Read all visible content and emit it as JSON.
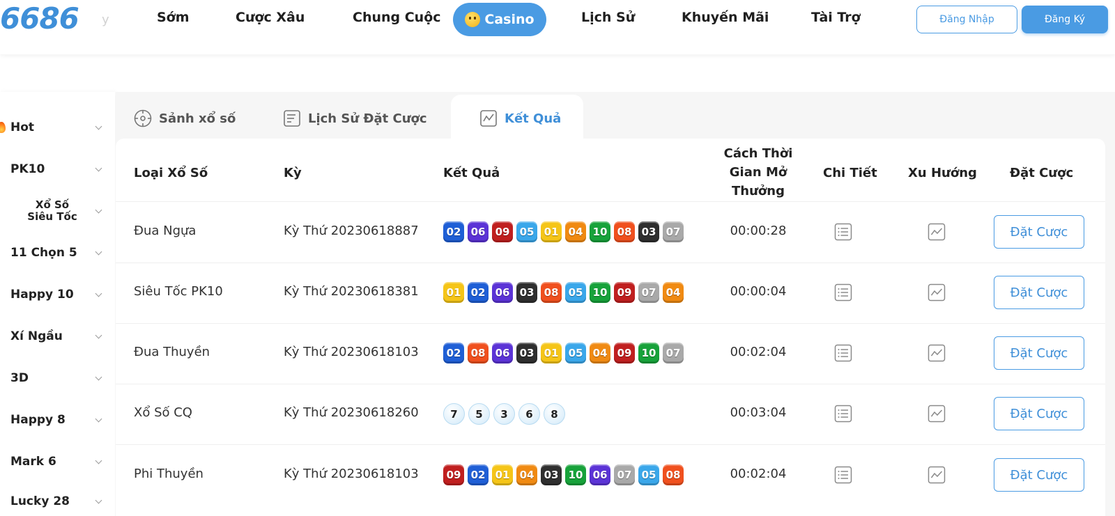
{
  "header": {
    "logo": "6686",
    "logo_tail": "y",
    "nav": [
      {
        "label": "Sớm"
      },
      {
        "label": "Cược Xâu"
      },
      {
        "label": "Chung Cuộc"
      },
      {
        "label": "Lịch Sử"
      },
      {
        "label": "Khuyến Mãi"
      },
      {
        "label": "Tài Trợ"
      }
    ],
    "casino_label": "Casino",
    "login_label": "Đăng Nhập",
    "register_label": "Đăng Ký"
  },
  "sidebar": {
    "items": [
      {
        "label": "Hot"
      },
      {
        "label": "PK10"
      },
      {
        "label": "Xổ Số Siêu Tốc"
      },
      {
        "label": "11 Chọn 5"
      },
      {
        "label": "Happy 10"
      },
      {
        "label": "Xí Ngầu"
      },
      {
        "label": "3D"
      },
      {
        "label": "Happy 8"
      },
      {
        "label": "Mark 6"
      },
      {
        "label": "Lucky 28"
      }
    ]
  },
  "tabs": [
    {
      "label": "Sảnh xổ số",
      "active": false
    },
    {
      "label": "Lịch Sử Đặt Cược",
      "active": false
    },
    {
      "label": "Kết Quả",
      "active": true
    }
  ],
  "table": {
    "headers": {
      "type": "Loại Xổ Số",
      "period": "Kỳ",
      "result": "Kết Quả",
      "countdown": "Cách Thời Gian Mở Thưởng",
      "detail": "Chi Tiết",
      "trend": "Xu Hướng",
      "bet": "Đặt Cược"
    },
    "rows": [
      {
        "name": "Đua Ngựa",
        "period": "Kỳ Thứ 20230618887",
        "balls": [
          "02",
          "06",
          "09",
          "05",
          "01",
          "04",
          "10",
          "08",
          "03",
          "07"
        ],
        "style": "pk10",
        "countdown": "00:00:28",
        "bet_label": "Đặt Cược"
      },
      {
        "name": "Siêu Tốc PK10",
        "period": "Kỳ Thứ 20230618381",
        "balls": [
          "01",
          "02",
          "06",
          "03",
          "08",
          "05",
          "10",
          "09",
          "07",
          "04"
        ],
        "style": "pk10",
        "countdown": "00:00:04",
        "bet_label": "Đặt Cược"
      },
      {
        "name": "Đua Thuyền",
        "period": "Kỳ Thứ 20230618103",
        "balls": [
          "02",
          "08",
          "06",
          "03",
          "01",
          "05",
          "04",
          "09",
          "10",
          "07"
        ],
        "style": "pk10",
        "countdown": "00:02:04",
        "bet_label": "Đặt Cược"
      },
      {
        "name": "Xổ Số CQ",
        "period": "Kỳ Thứ 20230618260",
        "balls": [
          "7",
          "5",
          "3",
          "6",
          "8"
        ],
        "style": "round",
        "countdown": "00:03:04",
        "bet_label": "Đặt Cược"
      },
      {
        "name": "Phi Thuyền",
        "period": "Kỳ Thứ 20230618103",
        "balls": [
          "09",
          "02",
          "01",
          "04",
          "03",
          "10",
          "06",
          "07",
          "05",
          "08"
        ],
        "style": "pk10",
        "countdown": "00:02:04",
        "bet_label": "Đặt Cược"
      }
    ]
  },
  "ball_colors": {
    "01": "#f5c518",
    "02": "#1f5fd6",
    "03": "#2f2f2f",
    "04": "#f08a12",
    "05": "#3aa7ea",
    "06": "#5b33d6",
    "07": "#a9a9a9",
    "08": "#f0501e",
    "09": "#c01f1f",
    "10": "#17a23a"
  }
}
